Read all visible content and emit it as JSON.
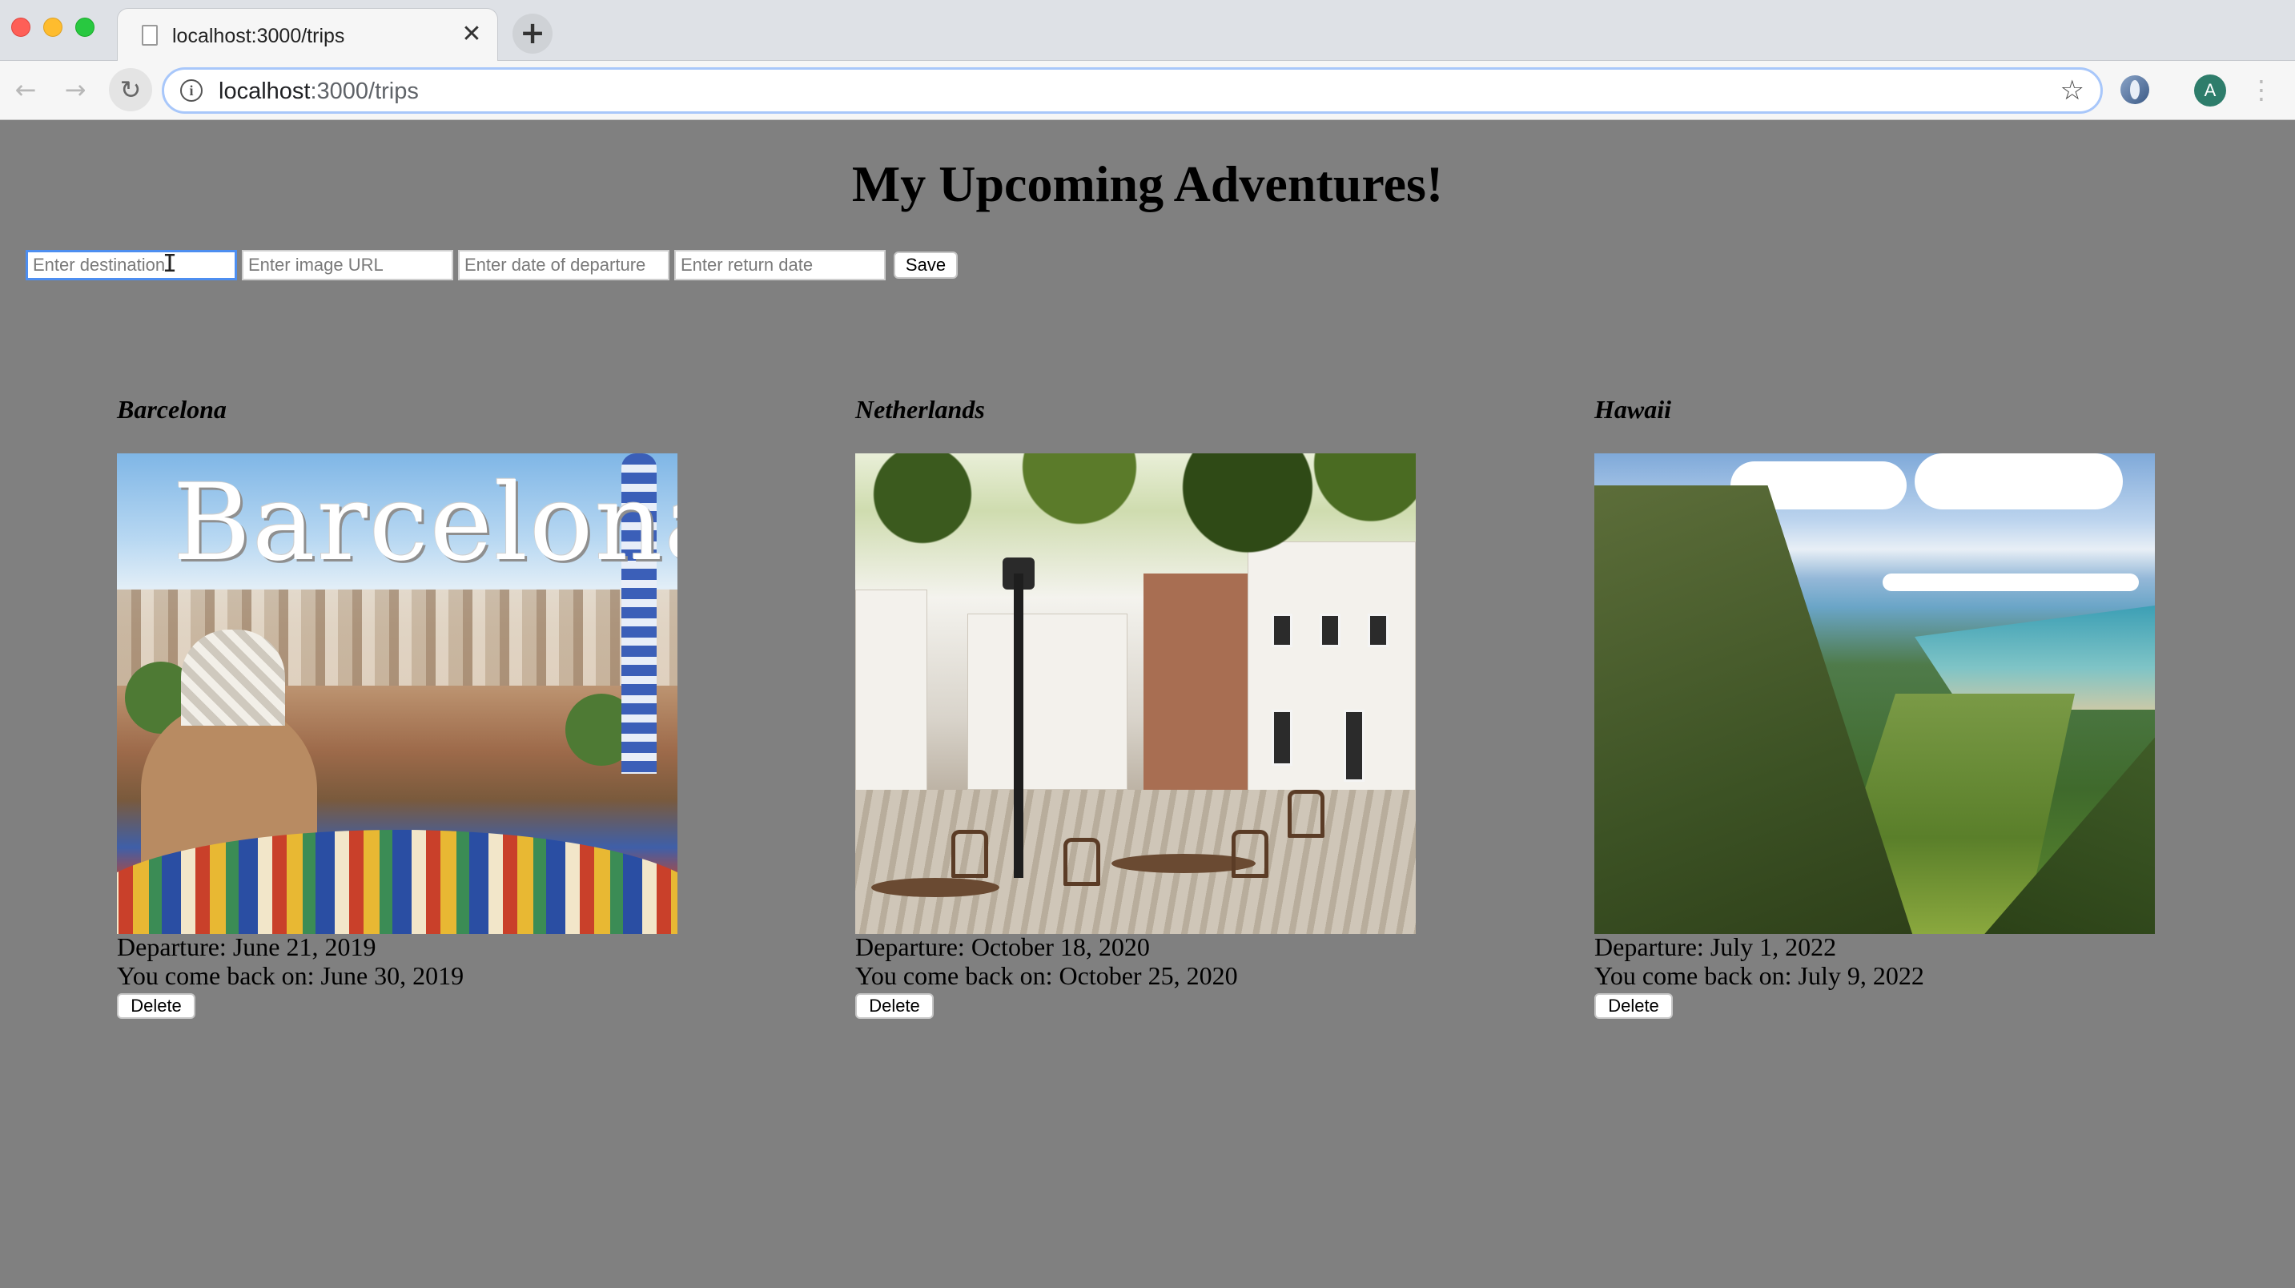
{
  "browser": {
    "tab_title": "localhost:3000/trips",
    "tab_close_glyph": "✕",
    "new_tab_glyph": "+",
    "url_host": "localhost",
    "url_path": ":3000/trips",
    "back_glyph": "←",
    "forward_glyph": "→",
    "reload_glyph": "↻",
    "info_glyph": "i",
    "star_glyph": "☆",
    "menu_glyph": "⋮",
    "avatar_letter": "A"
  },
  "page": {
    "heading": "My Upcoming Adventures!"
  },
  "form": {
    "destination_placeholder": "Enter destination",
    "image_url_placeholder": "Enter image URL",
    "departure_placeholder": "Enter date of departure",
    "return_placeholder": "Enter return date",
    "save_label": "Save"
  },
  "trips": [
    {
      "destination": "Barcelona",
      "image_text": "Barcelona",
      "departure": "Departure: June 21, 2019",
      "return": "You come back on: June 30, 2019",
      "delete_label": "Delete"
    },
    {
      "destination": "Netherlands",
      "departure": "Departure: October 18, 2020",
      "return": "You come back on: October 25, 2020",
      "delete_label": "Delete"
    },
    {
      "destination": "Hawaii",
      "departure": "Departure: July 1, 2022",
      "return": "You come back on: July 9, 2022",
      "delete_label": "Delete"
    }
  ],
  "colors": {
    "page_background": "#808080",
    "focus_ring": "#4d8ef0"
  }
}
